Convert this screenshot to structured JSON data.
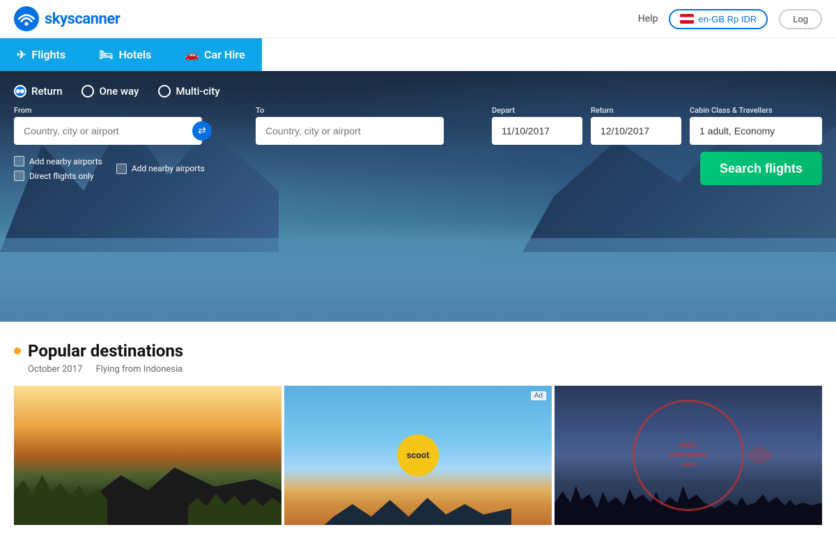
{
  "header": {
    "logo_text": "skyscanner",
    "help_label": "Help",
    "lang_label": "en-GB Rp IDR",
    "login_label": "Log"
  },
  "nav": {
    "tabs": [
      {
        "id": "flights",
        "label": "Flights",
        "icon": "✈",
        "active": true
      },
      {
        "id": "hotels",
        "label": "Hotels",
        "icon": "🛏",
        "active": false
      },
      {
        "id": "car-hire",
        "label": "Car Hire",
        "icon": "🚗",
        "active": false
      }
    ]
  },
  "search": {
    "trip_types": [
      {
        "id": "return",
        "label": "Return",
        "checked": true
      },
      {
        "id": "one-way",
        "label": "One way",
        "checked": false
      },
      {
        "id": "multi-city",
        "label": "Multi-city",
        "checked": false
      }
    ],
    "from_label": "From",
    "from_placeholder": "Country, city or airport",
    "to_label": "To",
    "to_placeholder": "Country, city or airport",
    "depart_label": "Depart",
    "depart_value": "11/10/2017",
    "return_label": "Return",
    "return_value": "12/10/2017",
    "cabin_label": "Cabin Class & Travellers",
    "cabin_value": "1 adult, Economy",
    "nearby_from": "Add nearby airports",
    "nearby_to": "Add nearby airports",
    "direct_only": "Direct flights only",
    "search_btn": "Search flights"
  },
  "popular": {
    "dot_color": "#f5a623",
    "title": "Popular destinations",
    "month": "October 2017",
    "flying_from": "Flying from Indonesia",
    "cards": [
      {
        "id": "card-volcano",
        "type": "volcano"
      },
      {
        "id": "card-opera",
        "type": "opera",
        "badge": "scoot",
        "ad": "Ad"
      },
      {
        "id": "card-watermark",
        "type": "watermark",
        "watermark_text": "www.antaranews.com"
      }
    ]
  }
}
